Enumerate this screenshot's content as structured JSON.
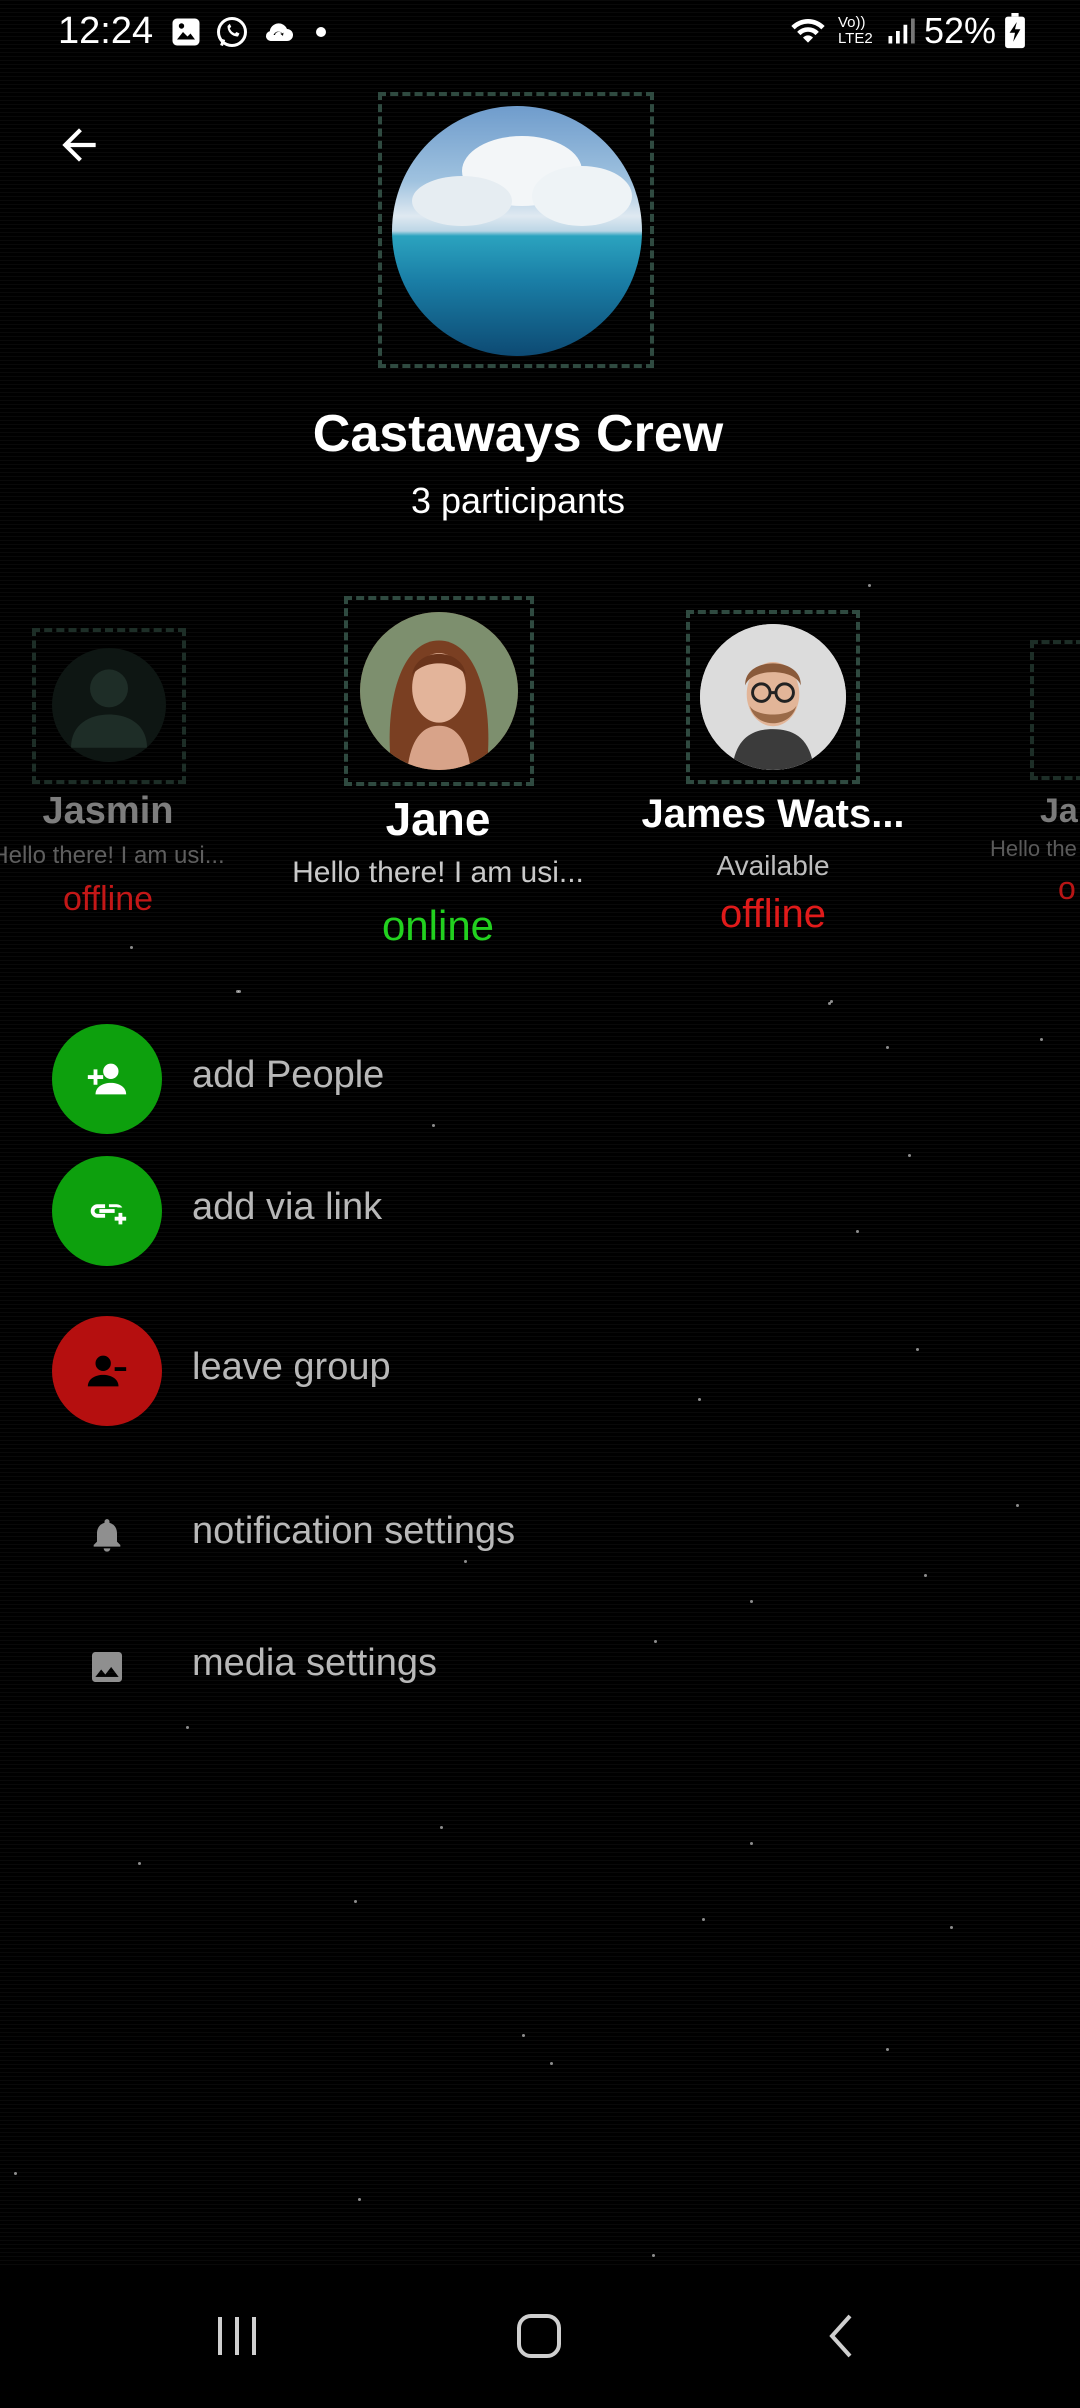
{
  "status_bar": {
    "time": "12:24",
    "battery": "52%",
    "left_icons": [
      "gallery-icon",
      "whatsapp-icon",
      "cloud-sync-icon",
      "dot-icon"
    ],
    "right_icons": [
      "wifi-icon",
      "volte-icon",
      "signal-icon",
      "battery-icon"
    ],
    "volte_label": "Vo)) LTE2"
  },
  "header": {
    "back_icon": "arrow-left-icon",
    "group_name": "Castaways Crew",
    "participants_count": "3 participants"
  },
  "participants": [
    {
      "name": "Jasmin",
      "status": "Hello there! I am usi...",
      "state": "offline",
      "state_color": "#d11a1a"
    },
    {
      "name": "Jane",
      "status": "Hello there! I am usi...",
      "state": "online",
      "state_color": "#22d11f"
    },
    {
      "name": "James Wats...",
      "status": "Available",
      "state": "offline",
      "state_color": "#e01a1a"
    },
    {
      "name": "Ja",
      "status": "Hello the",
      "state": "o",
      "state_color": "#d11a1a"
    }
  ],
  "menu": {
    "add_people": {
      "label": "add People",
      "icon": "person-add-icon",
      "color": "#0da00d"
    },
    "add_via_link": {
      "label": "add via link",
      "icon": "link-add-icon",
      "color": "#0da00d"
    },
    "leave_group": {
      "label": "leave group",
      "icon": "person-remove-icon",
      "color": "#b50f0f"
    },
    "notification_settings": {
      "label": "notification settings",
      "icon": "bell-icon"
    },
    "media_settings": {
      "label": "media settings",
      "icon": "image-icon"
    }
  },
  "nav": {
    "recents": "recents-icon",
    "home": "home-icon",
    "back": "back-icon"
  }
}
